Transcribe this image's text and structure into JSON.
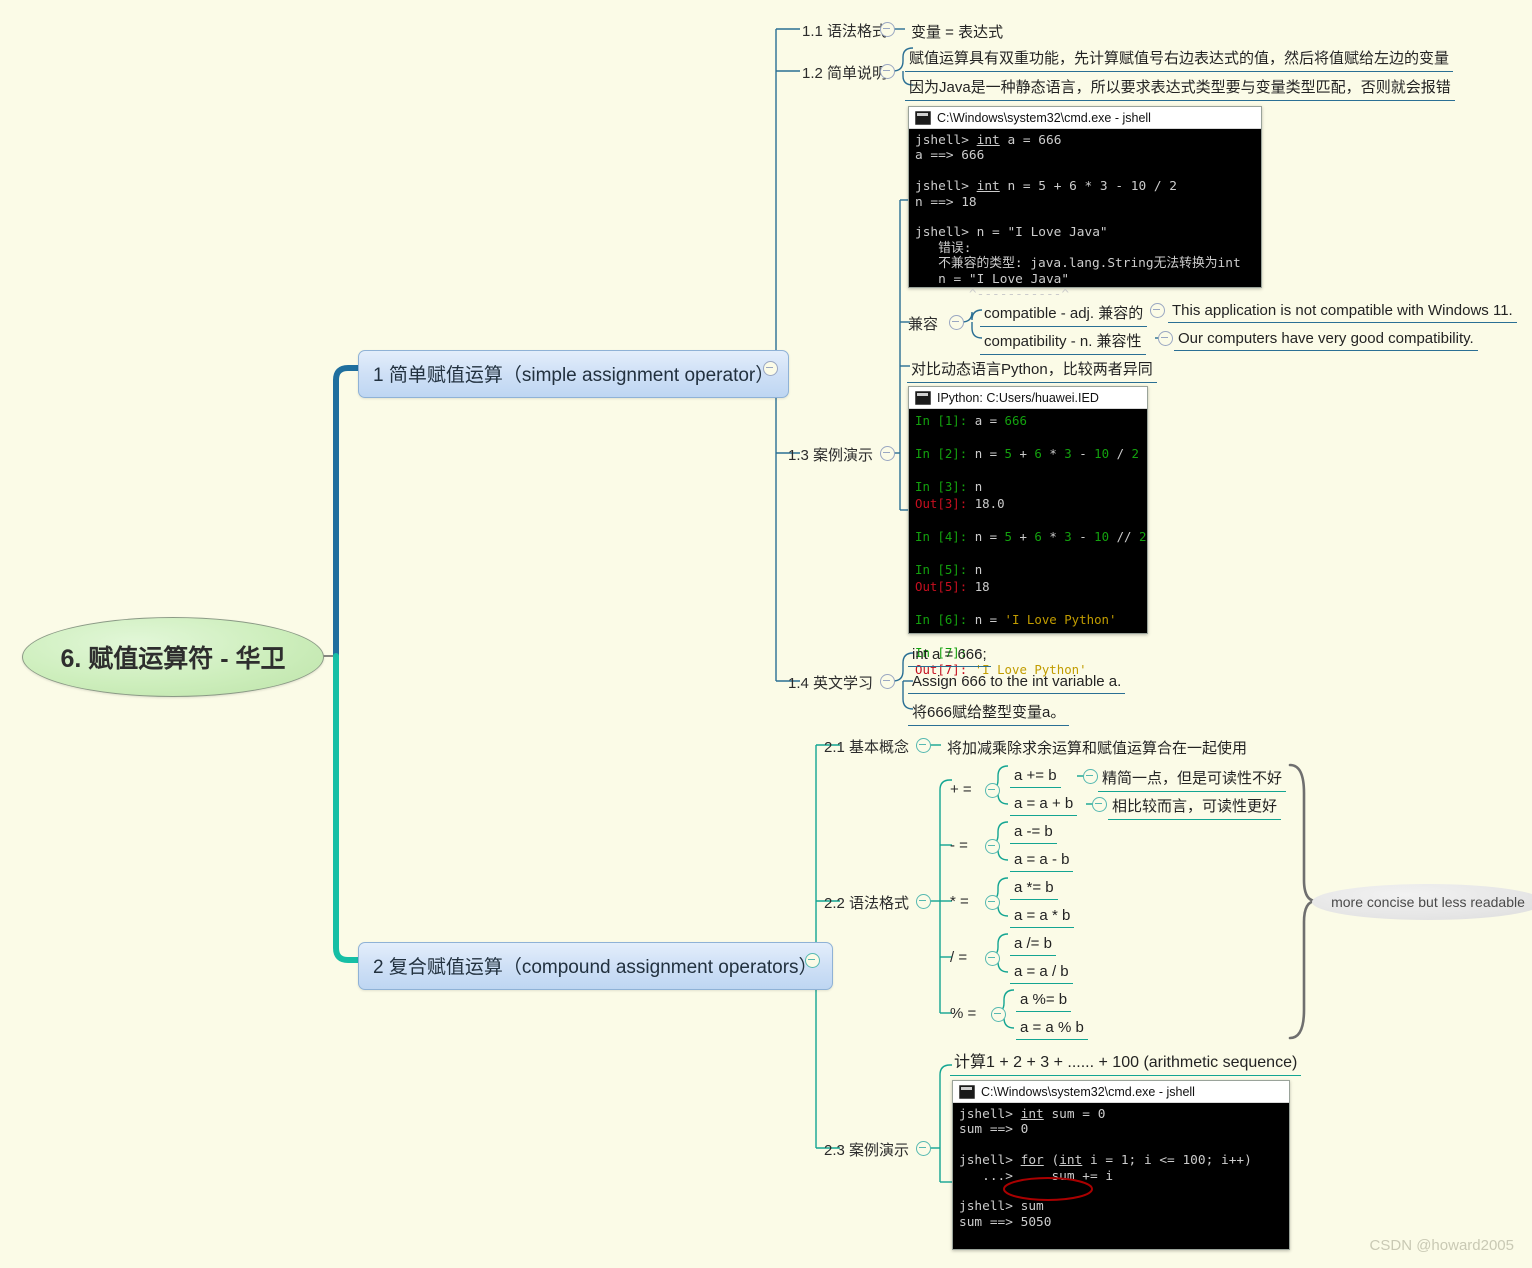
{
  "root": {
    "label": "6. 赋值运算符 - 华卫"
  },
  "watermark": "CSDN @howard2005",
  "topics": [
    {
      "label": "1 简单赋值运算（simple assignment operator）"
    },
    {
      "label": "2 复合赋值运算（compound assignment operators）"
    }
  ],
  "branch1": {
    "s11": {
      "label": "1.1 语法格式",
      "leaf": "变量 = 表达式"
    },
    "s12": {
      "label": "1.2 简单说明",
      "leaves": [
        "赋值运算具有双重功能，先计算赋值号右边表达式的值，然后将值赋给左边的变量",
        "因为Java是一种静态语言，所以要求表达式类型要与变量类型匹配，否则就会报错"
      ]
    },
    "s13": {
      "label": "1.3 案例演示",
      "compat_label": "兼容",
      "vocab": [
        {
          "word": "compatible - adj. 兼容的",
          "example": "This application is not compatible with Windows 11."
        },
        {
          "word": "compatibility - n. 兼容性",
          "example": "Our computers have very good compatibility."
        }
      ],
      "compare_note": "对比动态语言Python，比较两者异同"
    },
    "s14": {
      "label": "1.4 英文学习",
      "leaves": [
        "int a = 666;",
        "Assign 666 to the int variable a.",
        "将666赋给整型变量a。"
      ]
    }
  },
  "branch2": {
    "s21": {
      "label": "2.1 基本概念",
      "leaf": "将加减乘除求余运算和赋值运算合在一起使用"
    },
    "s22": {
      "label": "2.2 语法格式",
      "ops": [
        {
          "op": "+ =",
          "compound": "a += b",
          "expanded": "a = a + b",
          "note_compound": "精简一点，但是可读性不好",
          "note_expanded": "相比较而言，可读性更好"
        },
        {
          "op": "- =",
          "compound": "a -= b",
          "expanded": "a = a - b",
          "note_compound": "",
          "note_expanded": ""
        },
        {
          "op": "* =",
          "compound": "a *= b",
          "expanded": "a = a * b",
          "note_compound": "",
          "note_expanded": ""
        },
        {
          "op": "/ =",
          "compound": "a /= b",
          "expanded": "a = a / b",
          "note_compound": "",
          "note_expanded": ""
        },
        {
          "op": "% =",
          "compound": "a %= b",
          "expanded": "a = a % b",
          "note_compound": "",
          "note_expanded": ""
        }
      ],
      "bubble": "more concise but less readable"
    },
    "s23": {
      "label": "2.3 案例演示",
      "leaf": "计算1 + 2 + 3 + ...... + 100 (arithmetic sequence)"
    }
  },
  "terminals": {
    "jshell1": {
      "title": "C:\\Windows\\system32\\cmd.exe - jshell",
      "icon": "console-icon",
      "lines": [
        "jshell> int a = 666",
        "a ==> 666",
        "",
        "jshell> int n = 5 + 6 * 3 - 10 / 2",
        "n ==> 18",
        "",
        "jshell> n = \"I Love Java\"",
        "   错误:",
        "   不兼容的类型: java.lang.String无法转换为int",
        "   n = \"I Love Java\"",
        "       ^-----------^"
      ]
    },
    "ipython": {
      "title": "IPython: C:Users/huawei.IED",
      "icon": "console-icon",
      "lines": [
        "In [1]: a = 666",
        "In [2]: n = 5 + 6 * 3 - 10 / 2",
        "In [3]: n",
        "Out[3]: 18.0",
        "In [4]: n = 5 + 6 * 3 - 10 // 2",
        "In [5]: n",
        "Out[5]: 18",
        "In [6]: n = 'I Love Python'",
        "In [7]: n",
        "Out[7]: 'I Love Python'"
      ]
    },
    "jshell2": {
      "title": "C:\\Windows\\system32\\cmd.exe - jshell",
      "icon": "console-icon",
      "lines": [
        "jshell> int sum = 0",
        "sum ==> 0",
        "",
        "jshell> for (int i = 1; i <= 100; i++)",
        "   ...>     sum += i",
        "",
        "jshell> sum",
        "sum ==> 5050"
      ],
      "highlight": "sum += i"
    }
  },
  "colors": {
    "background": "#fbfbe7",
    "branch1_line": "#1f6f9e",
    "branch2_line": "#16bfa5",
    "sub1_line": "#2a6f94",
    "sub2_line": "#13a592",
    "root_fill": "#cdeebc",
    "topic_fill": "#cfe0f6",
    "highlight_ellipse": "#aa0000"
  }
}
